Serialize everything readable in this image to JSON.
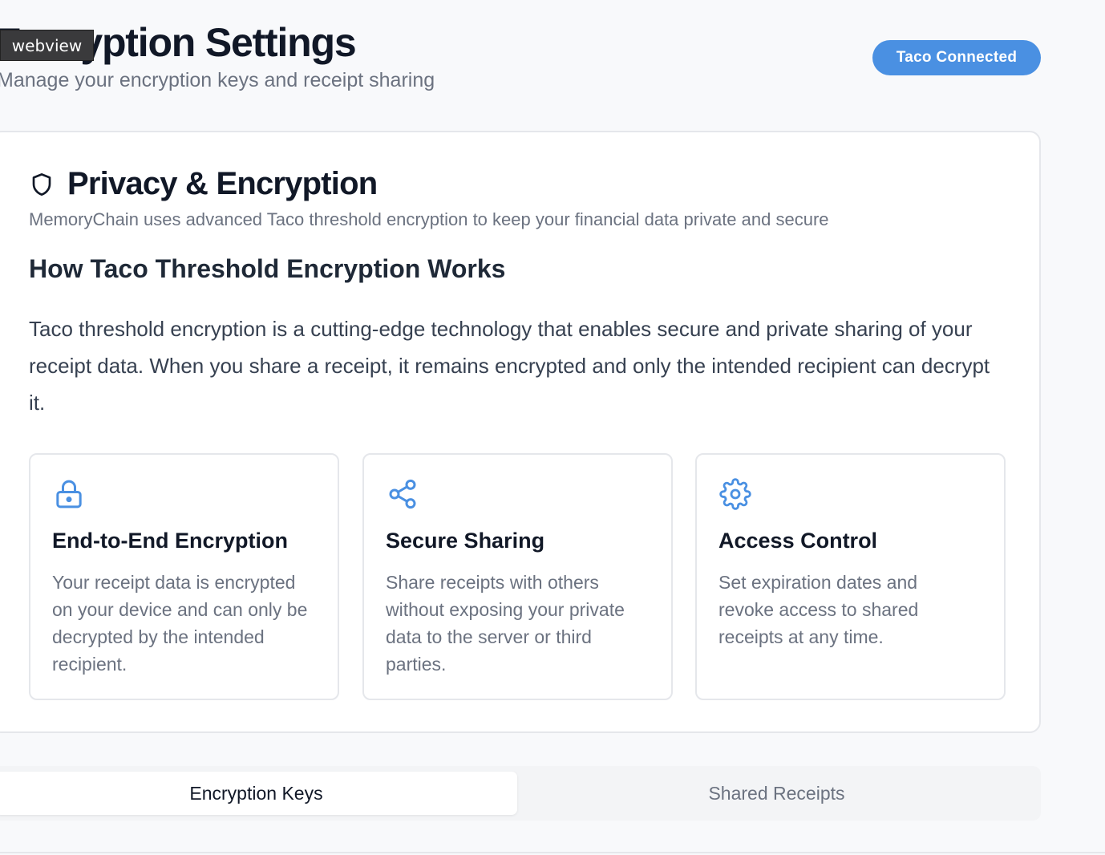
{
  "header": {
    "title": "Encryption Settings",
    "subtitle": "Manage your encryption keys and receipt sharing",
    "status_badge": "Taco Connected"
  },
  "overlay": {
    "webview_label": "webview"
  },
  "privacy_card": {
    "title": "Privacy & Encryption",
    "icon": "shield-icon",
    "description": "MemoryChain uses advanced Taco threshold encryption to keep your financial data private and secure",
    "section_heading": "How Taco Threshold Encryption Works",
    "section_body": "Taco threshold encryption is a cutting-edge technology that enables secure and private sharing of your receipt data. When you share a receipt, it remains encrypted and only the intended recipient can decrypt it.",
    "features": [
      {
        "icon": "lock-icon",
        "title": "End-to-End Encryption",
        "body": "Your receipt data is encrypted on your device and can only be decrypted by the intended recipient."
      },
      {
        "icon": "share-icon",
        "title": "Secure Sharing",
        "body": "Share receipts with others without exposing your private data to the server or third parties."
      },
      {
        "icon": "gear-icon",
        "title": "Access Control",
        "body": "Set expiration dates and revoke access to shared receipts at any time."
      }
    ]
  },
  "tabs": [
    {
      "label": "Encryption Keys",
      "active": true
    },
    {
      "label": "Shared Receipts",
      "active": false
    }
  ],
  "colors": {
    "accent": "#4a90e2",
    "text_primary": "#111827",
    "text_muted": "#6b7280",
    "border": "#e5e7eb",
    "page_bg": "#f8f9fb"
  }
}
